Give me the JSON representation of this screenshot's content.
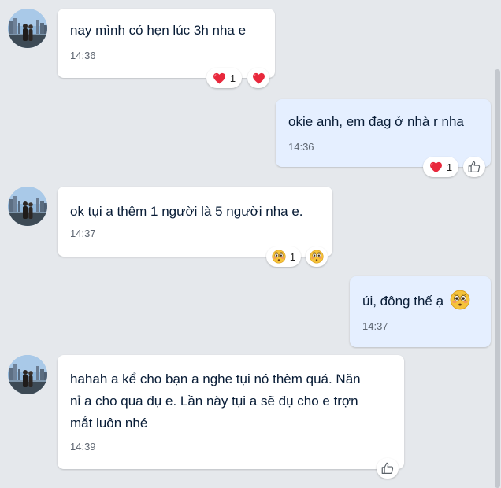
{
  "messages": [
    {
      "direction": "incoming",
      "text": "nay mình có hẹn lúc 3h nha e",
      "time": "14:36",
      "reaction": {
        "icon": "heart-icon",
        "count": "1"
      },
      "quick_react_icon": "heart-icon"
    },
    {
      "direction": "outgoing",
      "text": "okie anh, em đag ở nhà r nha",
      "time": "14:36",
      "reaction": {
        "icon": "heart-icon",
        "count": "1"
      },
      "quick_react_icon": "like-icon"
    },
    {
      "direction": "incoming",
      "text": "ok tụi a thêm 1 người là 5 người nha e.",
      "time": "14:37",
      "reaction": {
        "icon": "flushed-face-icon",
        "count": "1"
      },
      "quick_react_icon": "flushed-face-icon"
    },
    {
      "direction": "outgoing",
      "text": "úi, đông thế ạ",
      "emoji": "flushed-face-icon",
      "time": "14:37"
    },
    {
      "direction": "incoming",
      "lines": [
        "hahah a kể cho bạn a nghe tụi nó thèm quá. Năn",
        "nỉ a cho qua đụ e. Lần này tụi a sẽ đụ cho e trợn",
        "mắt luôn nhé"
      ],
      "time": "14:39",
      "quick_react_icon": "like-icon"
    }
  ],
  "colors": {
    "background": "#e5e8ec",
    "incoming_bubble": "#ffffff",
    "outgoing_bubble": "#e5efff",
    "text": "#081c36",
    "time": "#5d6570",
    "heart": "#e8283c",
    "emoji_face": "#f5c33b"
  }
}
